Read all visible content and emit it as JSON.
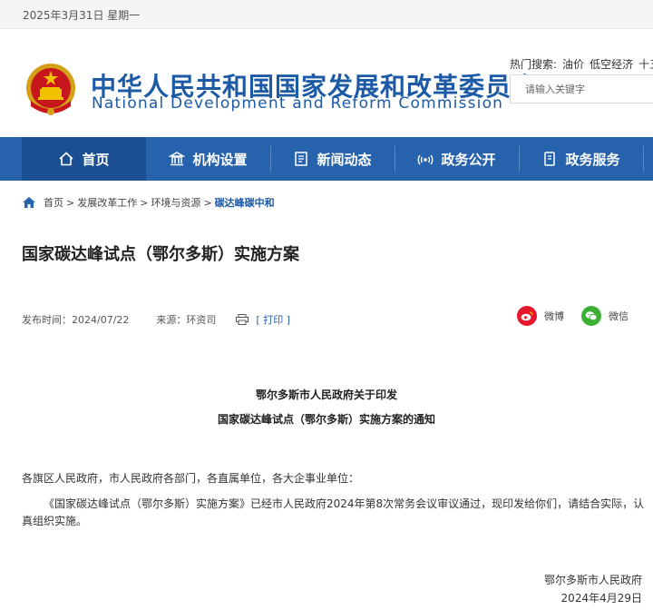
{
  "topbar": {
    "date": "2025年3月31日 星期一"
  },
  "header": {
    "title_cn": "中华人民共和国国家发展和改革委员会",
    "title_en": "National Development and Reform Commission",
    "hot_label": "热门搜索:",
    "hot_keywords": [
      "油价",
      "低空经济",
      "十五"
    ],
    "search_placeholder": "请输入关键字"
  },
  "nav": {
    "items": [
      {
        "label": "首页",
        "icon": "home-icon"
      },
      {
        "label": "机构设置",
        "icon": "building-icon"
      },
      {
        "label": "新闻动态",
        "icon": "news-icon"
      },
      {
        "label": "政务公开",
        "icon": "broadcast-icon"
      },
      {
        "label": "政务服务",
        "icon": "document-icon"
      }
    ]
  },
  "breadcrumb": {
    "items": [
      "首页",
      "发展改革工作",
      "环境与资源"
    ],
    "separator": ">",
    "current": "碳达峰碳中和"
  },
  "article": {
    "title": "国家碳达峰试点（鄂尔多斯）实施方案",
    "publish_time": "发布时间：2024/07/22",
    "source": "来源：环资司",
    "print_label": "[ 打印 ]",
    "share": [
      {
        "label": "微博",
        "icon": "weibo-icon",
        "color": "#e6162d"
      },
      {
        "label": "微信",
        "icon": "wechat-icon",
        "color": "#3cb034"
      }
    ],
    "notice_title_1": "鄂尔多斯市人民政府关于印发",
    "notice_title_2": "国家碳达峰试点（鄂尔多斯）实施方案的通知",
    "salutation": "各旗区人民政府，市人民政府各部门，各直属单位，各大企事业单位：",
    "body": "《国家碳达峰试点（鄂尔多斯）实施方案》已经市人民政府2024年第8次常务会议审议通过，现印发给你们，请结合实际，认真组织实施。",
    "signature": "鄂尔多斯市人民政府",
    "sign_date": "2024年4月29日"
  },
  "colors": {
    "brand_blue": "#1c5aa6",
    "nav_bg": "#2762ac",
    "nav_active": "#1b4f93"
  }
}
